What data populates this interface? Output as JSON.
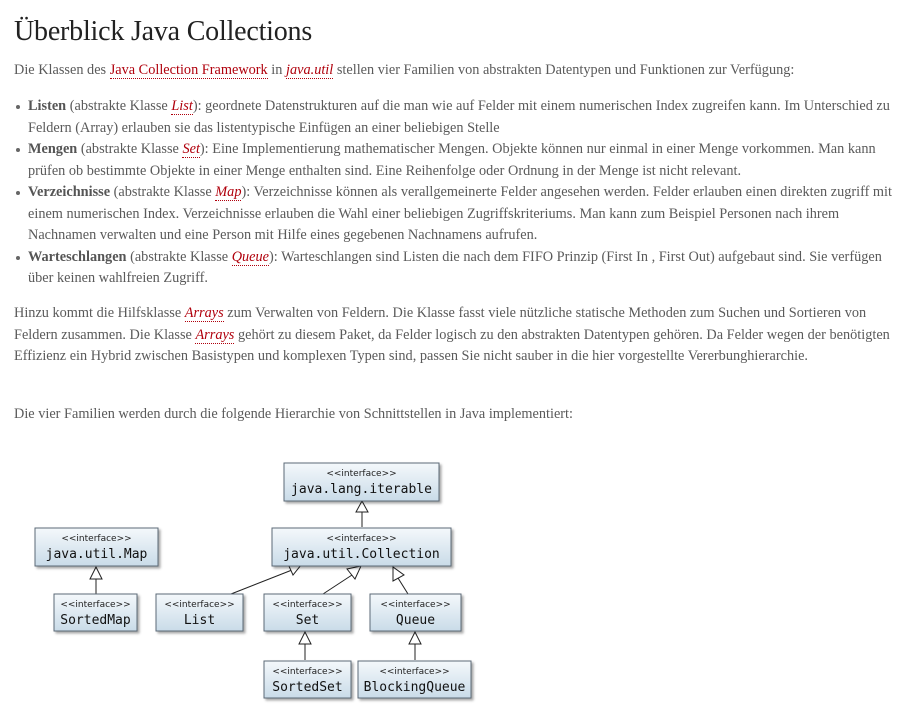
{
  "title": "Überblick Java Collections",
  "intro": {
    "pre": "Die Klassen des ",
    "link1": "Java Collection Framework",
    "mid": " in ",
    "link2": "java.util",
    "post": " stellen vier Familien von abstrakten Datentypen und Funktionen zur Verfügung:"
  },
  "families": [
    {
      "name": "Listen",
      "pre": " (abstrakte Klasse ",
      "link": "List",
      "post": "): geordnete Datenstrukturen auf die man wie auf Felder mit einem numerischen Index zugreifen kann. Im Unterschied zu Feldern (Array) erlauben sie das listentypische Einfügen an einer beliebigen Stelle"
    },
    {
      "name": "Mengen",
      "pre": " (abstrakte Klasse ",
      "link": "Set",
      "post": "): Eine Implementierung mathematischer Mengen. Objekte können nur einmal in einer Menge vorkommen. Man kann prüfen ob bestimmte Objekte in einer Menge enthalten sind. Eine Reihenfolge oder Ordnung in der Menge ist nicht relevant."
    },
    {
      "name": "Verzeichnisse",
      "pre": " (abstrakte Klasse ",
      "link": "Map",
      "post": "): Verzeichnisse können als verallgemeinerte Felder angesehen werden. Felder erlauben einen direkten zugriff mit einem numerischen Index. Verzeichnisse erlauben die Wahl einer beliebigen Zugriffskriteriums. Man kann zum Beispiel Personen nach ihrem Nachnamen verwalten und eine Person mit Hilfe eines gegebenen Nachnamens aufrufen."
    },
    {
      "name": "Warteschlangen",
      "pre": " (abstrakte Klasse ",
      "link": "Queue",
      "post": "): Warteschlangen sind Listen die nach dem FIFO Prinzip (First In , First Out) aufgebaut sind. Sie verfügen über keinen wahlfreien Zugriff."
    }
  ],
  "arrays_paragraph": {
    "s1": "Hinzu kommt die Hilfsklasse ",
    "link1": "Arrays",
    "s2": " zum Verwalten von Feldern. Die Klasse fasst viele nützliche statische Methoden zum Suchen und Sortieren von Feldern zusammen. Die Klasse ",
    "link2": "Arrays",
    "s3": " gehört zu diesem Paket, da Felder logisch zu den abstrakten Datentypen gehören. Da Felder wegen der benötigten Effizienz  ein Hybrid zwischen Basistypen und komplexen Typen sind, passen Sie nicht sauber in die hier vorgestellte Vererbunghierarchie."
  },
  "hierarchy_intro": "Die vier Familien werden durch die folgende Hierarchie von Schnittstellen in Java implementiert:",
  "diagram": {
    "stereotype": "<<interface>>",
    "nodes": {
      "iterable": "java.lang.iterable",
      "collection": "java.util.Collection",
      "map": "java.util.Map",
      "sortedmap": "SortedMap",
      "list": "List",
      "set": "Set",
      "queue": "Queue",
      "sortedset": "SortedSet",
      "blockingqueue": "BlockingQueue"
    },
    "colors": {
      "box_top": "#f4f8fb",
      "box_bottom": "#c9dbe8",
      "border": "#5c6b77"
    }
  }
}
